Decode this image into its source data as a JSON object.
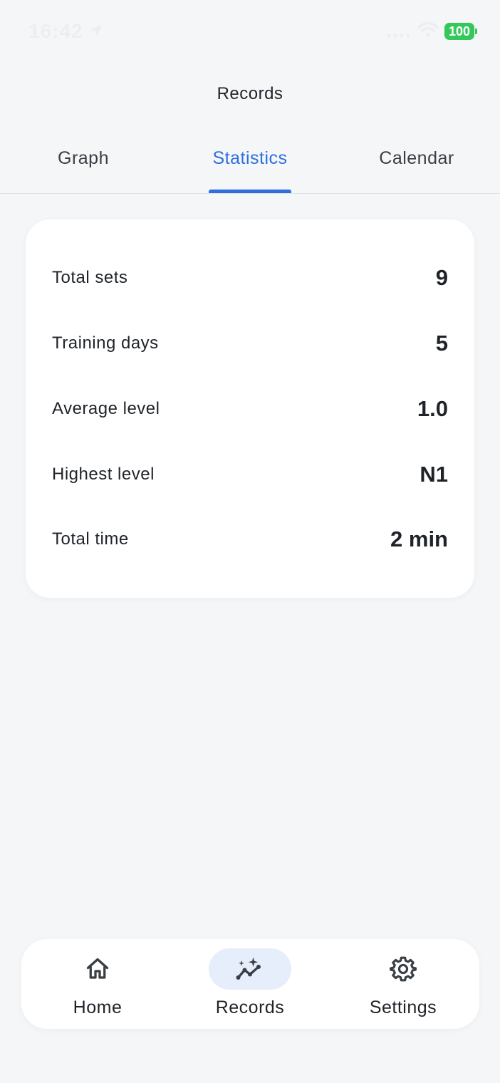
{
  "status_bar": {
    "time": "16:42",
    "battery": "100"
  },
  "header": {
    "title": "Records"
  },
  "tabs": [
    {
      "label": "Graph",
      "active": false
    },
    {
      "label": "Statistics",
      "active": true
    },
    {
      "label": "Calendar",
      "active": false
    }
  ],
  "stats": [
    {
      "label": "Total sets",
      "value": "9"
    },
    {
      "label": "Training days",
      "value": "5"
    },
    {
      "label": "Average level",
      "value": "1.0"
    },
    {
      "label": "Highest level",
      "value": "N1"
    },
    {
      "label": "Total time",
      "value": "2 min"
    }
  ],
  "nav": [
    {
      "label": "Home",
      "icon": "home-icon",
      "active": false
    },
    {
      "label": "Records",
      "icon": "chart-sparkle-icon",
      "active": true
    },
    {
      "label": "Settings",
      "icon": "gear-icon",
      "active": false
    }
  ],
  "colors": {
    "accent": "#2f6fde",
    "background": "#f4f6f8",
    "card": "#ffffff",
    "battery": "#34c759",
    "active_nav_bg": "#e6eefc"
  }
}
